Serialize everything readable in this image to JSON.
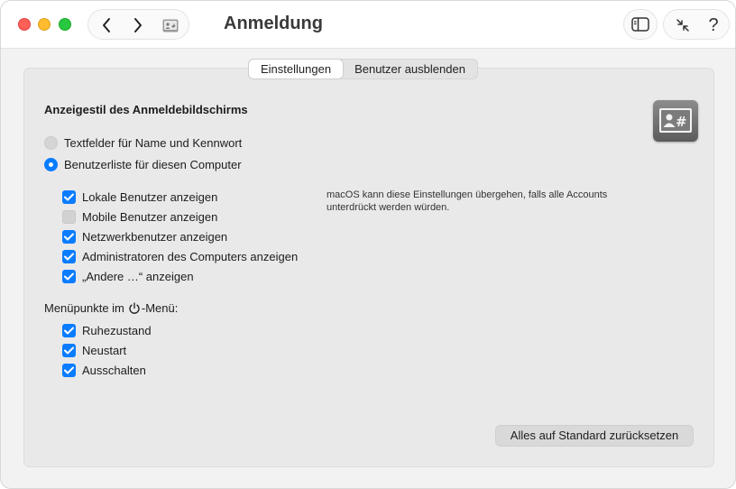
{
  "window": {
    "title": "Anmeldung"
  },
  "tabs": [
    {
      "label": "Einstellungen",
      "active": true
    },
    {
      "label": "Benutzer ausblenden",
      "active": false
    }
  ],
  "display_style": {
    "heading": "Anzeigestil des Anmeldebildschirms",
    "options": [
      {
        "label": "Textfelder für Name und Kennwort",
        "selected": false
      },
      {
        "label": "Benutzerliste für diesen Computer",
        "selected": true
      }
    ]
  },
  "user_list_options": [
    {
      "label": "Lokale Benutzer anzeigen",
      "checked": true
    },
    {
      "label": "Mobile Benutzer anzeigen",
      "checked": false
    },
    {
      "label": "Netzwerkbenutzer anzeigen",
      "checked": true
    },
    {
      "label": "Administratoren des Computers anzeigen",
      "checked": true
    },
    {
      "label": "„Andere …“ anzeigen",
      "checked": true
    }
  ],
  "note": "macOS kann diese Einstellungen übergehen, falls alle Accounts unterdrückt werden würden.",
  "menu_items": {
    "label_prefix": "Menüpunkte im",
    "label_suffix": "-Menü:",
    "items": [
      {
        "label": "Ruhezustand",
        "checked": true
      },
      {
        "label": "Neustart",
        "checked": true
      },
      {
        "label": "Ausschalten",
        "checked": true
      }
    ]
  },
  "reset_button": "Alles auf Standard zurücksetzen",
  "toolbar": {
    "help_label": "?"
  },
  "colors": {
    "accent": "#0a7cff",
    "close": "#ff5f57",
    "minimize": "#febc2e",
    "maximize": "#28c840"
  }
}
